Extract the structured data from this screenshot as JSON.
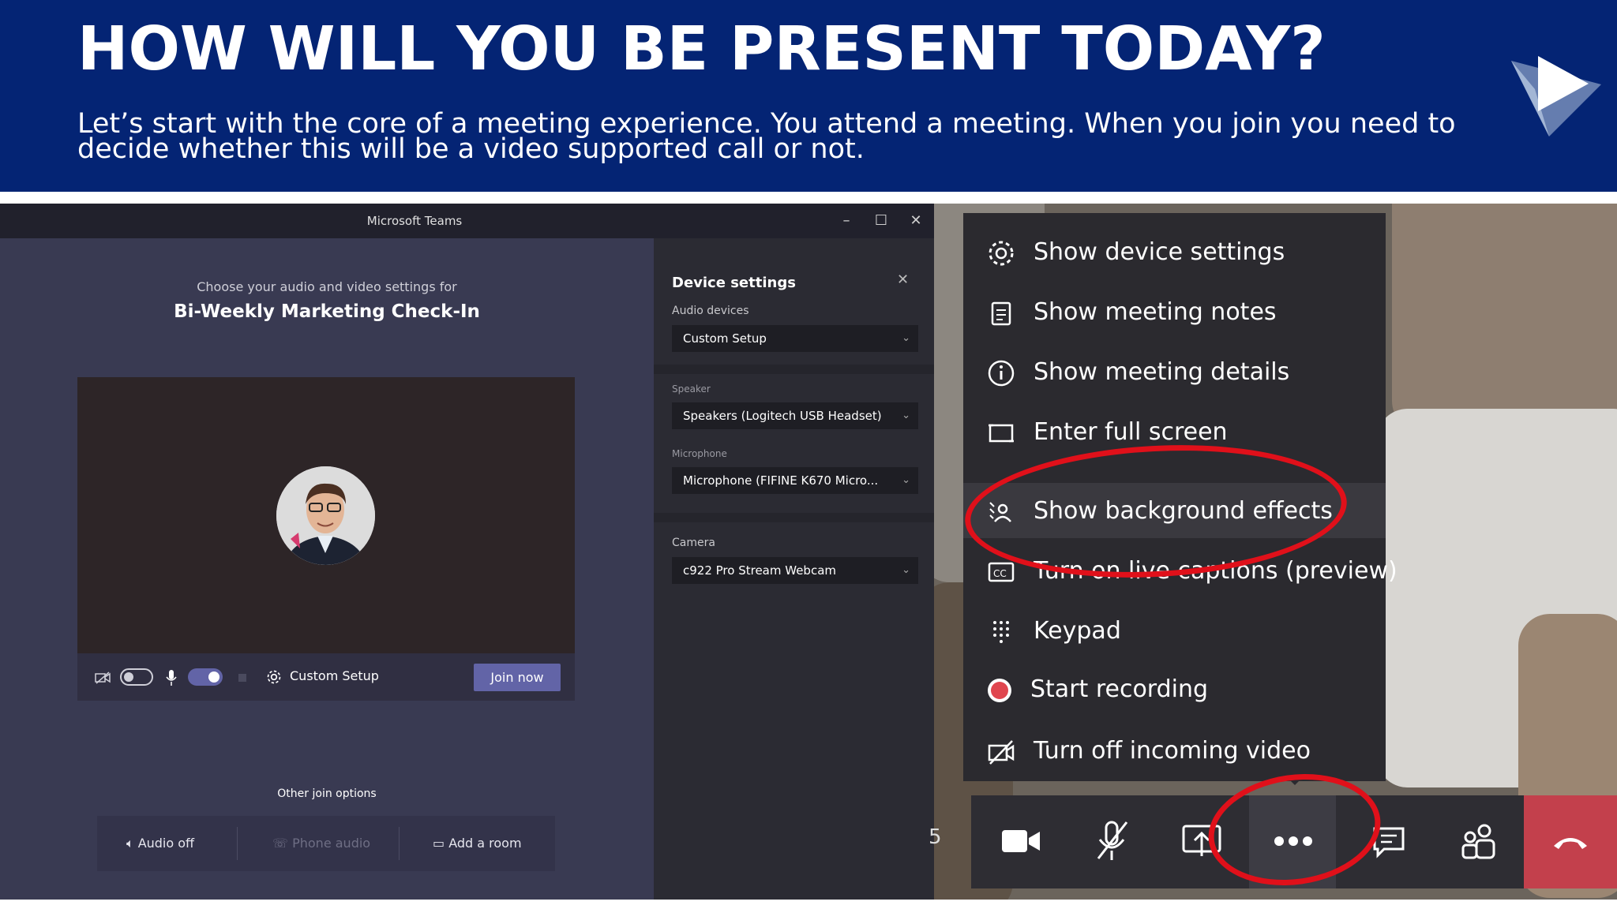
{
  "header": {
    "title": "HOW WILL YOU BE PRESENT TODAY?",
    "subtitle": "Let’s start with the core of a meeting experience. You attend a meeting. When you join you need to decide whether this will be a video supported call or not."
  },
  "teams": {
    "window_title": "Microsoft Teams",
    "prejoin_subtitle": "Choose your audio and video settings for",
    "meeting_title": "Bi-Weekly Marketing Check-In",
    "controls": {
      "device_label": "Custom Setup",
      "join_label": "Join now"
    },
    "other_options": {
      "label": "Other join options",
      "audio_off": "Audio off",
      "phone_audio": "Phone audio",
      "add_room": "Add a room"
    },
    "device_settings": {
      "title": "Device settings",
      "audio_devices_label": "Audio devices",
      "audio_devices_value": "Custom Setup",
      "speaker_label": "Speaker",
      "speaker_value": "Speakers (Logitech USB Headset)",
      "microphone_label": "Microphone",
      "microphone_value": "Microphone (FIFINE K670 Micro...",
      "camera_label": "Camera",
      "camera_value": "c922 Pro Stream Webcam"
    }
  },
  "menu": {
    "items": [
      {
        "label": "Show device settings",
        "icon": "gear-icon"
      },
      {
        "label": "Show meeting notes",
        "icon": "notes-icon"
      },
      {
        "label": "Show meeting details",
        "icon": "info-icon"
      },
      {
        "label": "Enter full screen",
        "icon": "fullscreen-icon"
      },
      {
        "label": "Show background effects",
        "icon": "background-effects-icon"
      },
      {
        "label": "Turn on live captions (preview)",
        "icon": "captions-icon"
      },
      {
        "label": "Keypad",
        "icon": "keypad-icon"
      },
      {
        "label": "Start recording",
        "icon": "record-icon"
      },
      {
        "label": "Turn off incoming video",
        "icon": "video-off-icon"
      }
    ]
  },
  "toolbar": {
    "partial_count": "5"
  },
  "colors": {
    "banner": "#042474",
    "teams_purple": "#6264a7",
    "hangup": "#c3404c",
    "annotation_red": "#e0101a",
    "record_red": "#e0464f"
  }
}
